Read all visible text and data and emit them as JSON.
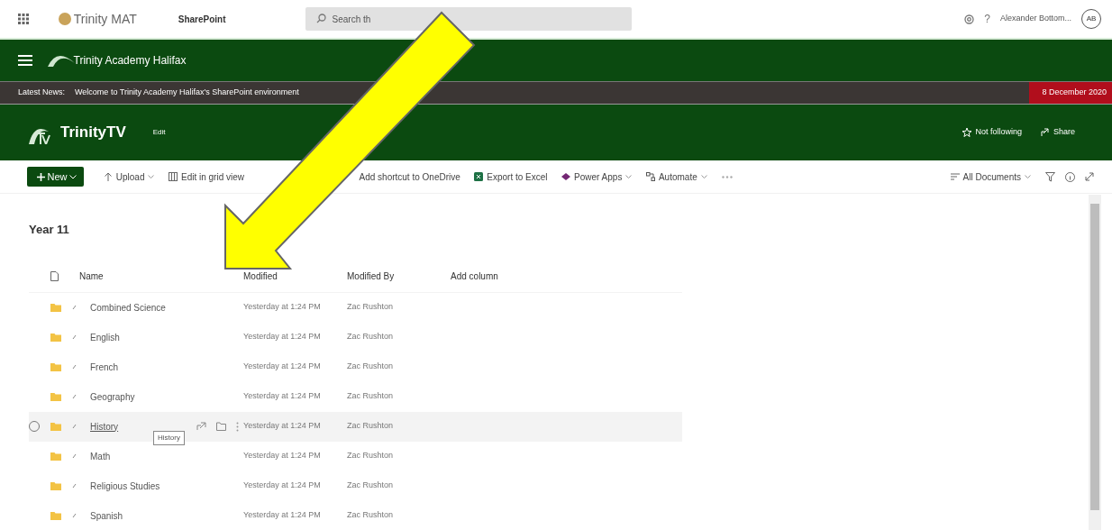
{
  "suite_bar": {
    "org": "Trinity MAT",
    "app": "SharePoint",
    "search": {
      "placeholder": "Search th"
    },
    "help": "?",
    "user": "Alexander Bottom...",
    "initials": "AB"
  },
  "site_header": {
    "title": "Trinity Academy Halifax"
  },
  "news": {
    "label": "Latest News:",
    "text": "Welcome to Trinity Academy Halifax's SharePoint environment",
    "date": "8 December 2020"
  },
  "subsite": {
    "title": "TrinityTV",
    "edit": "Edit",
    "actions": [
      {
        "kind": "follow",
        "label": "Not following"
      },
      {
        "kind": "share",
        "label": "Share"
      }
    ]
  },
  "command_bar": {
    "new": "New",
    "items": [
      {
        "kind": "upload",
        "label": "Upload",
        "dropdown": true
      },
      {
        "kind": "grid",
        "label": "Edit in grid view",
        "dropdown": false
      },
      {
        "kind": "shortcut",
        "label": "Add shortcut to OneDrive",
        "dropdown": false
      },
      {
        "kind": "excel",
        "label": "Export to Excel",
        "dropdown": false
      },
      {
        "kind": "powerapps",
        "label": "Power Apps",
        "dropdown": true
      },
      {
        "kind": "automate",
        "label": "Automate",
        "dropdown": true
      }
    ],
    "view": "All Documents"
  },
  "library": {
    "title": "Year 11",
    "columns": [
      "Name",
      "Modified",
      "Modified By",
      "Add column"
    ],
    "rows": [
      {
        "name": "Combined Science",
        "modified": "Yesterday at 1:24 PM",
        "modified_by": "Zac Rushton",
        "hovered": false
      },
      {
        "name": "English",
        "modified": "Yesterday at 1:24 PM",
        "modified_by": "Zac Rushton",
        "hovered": false
      },
      {
        "name": "French",
        "modified": "Yesterday at 1:24 PM",
        "modified_by": "Zac Rushton",
        "hovered": false
      },
      {
        "name": "Geography",
        "modified": "Yesterday at 1:24 PM",
        "modified_by": "Zac Rushton",
        "hovered": false
      },
      {
        "name": "History",
        "modified": "Yesterday at 1:24 PM",
        "modified_by": "Zac Rushton",
        "hovered": true
      },
      {
        "name": "Math",
        "modified": "Yesterday at 1:24 PM",
        "modified_by": "Zac Rushton",
        "hovered": false
      },
      {
        "name": "Religious Studies",
        "modified": "Yesterday at 1:24 PM",
        "modified_by": "Zac Rushton",
        "hovered": false
      },
      {
        "name": "Spanish",
        "modified": "Yesterday at 1:24 PM",
        "modified_by": "Zac Rushton",
        "hovered": false
      }
    ],
    "tooltip": "History"
  }
}
